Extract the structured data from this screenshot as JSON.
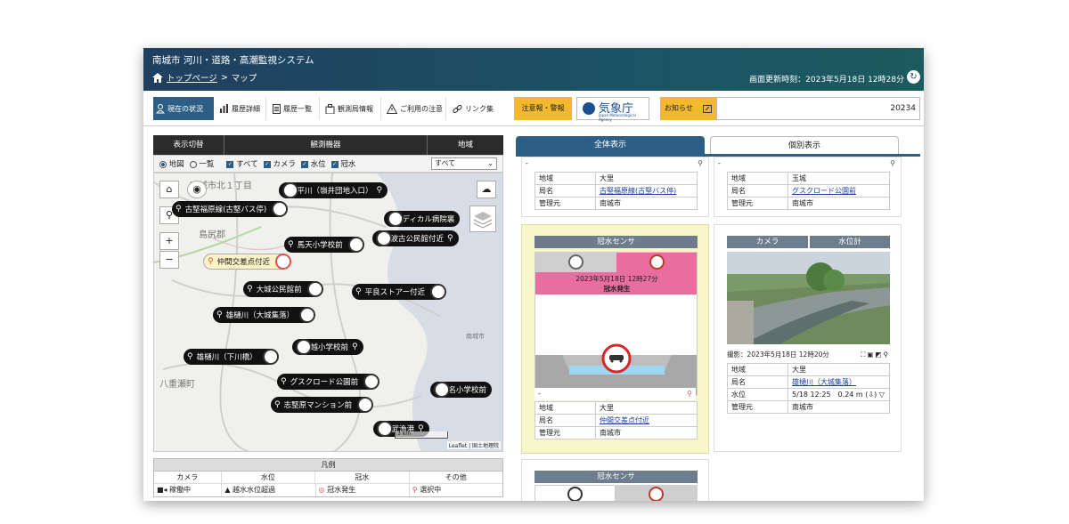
{
  "header": {
    "system_title": "南城市 河川・道路・高潮監視システム",
    "breadcrumb_home": "トップページ",
    "breadcrumb_sep": ">",
    "breadcrumb_current": "マップ",
    "updated_label": "画面更新時刻：2023年5月18日 12時28分"
  },
  "toolbar": {
    "items": [
      {
        "label": "現在の状況",
        "icon": "person-pin-icon"
      },
      {
        "label": "履歴詳細",
        "icon": "bar-chart-icon"
      },
      {
        "label": "履歴一覧",
        "icon": "list-icon"
      },
      {
        "label": "観測局情報",
        "icon": "building-icon"
      },
      {
        "label": "ご利用の注意",
        "icon": "warning-icon"
      },
      {
        "label": "リンク集",
        "icon": "link-icon"
      }
    ],
    "alert_label": "注意報・警報",
    "jma_name": "気象庁",
    "jma_sub": "Japan Meteorological Agency",
    "notice_label": "お知らせ",
    "notice_text": "20234"
  },
  "left_panel": {
    "headers": [
      "表示切替",
      "観測機器",
      "地域"
    ],
    "view_options": [
      "地図",
      "一覧"
    ],
    "filters": [
      "すべて",
      "カメラ",
      "水位",
      "冠水"
    ],
    "region_select": "すべて"
  },
  "map": {
    "area_labels": [
      "南城市北１丁目",
      "島尻郡",
      "八重瀬町",
      "南城市"
    ],
    "markers": [
      {
        "label": "宮平川（嶺井団地入口）"
      },
      {
        "label": "古堅福原線(古堅バス停)"
      },
      {
        "label": "メディカル病院裏"
      },
      {
        "label": "津波古公民館付近"
      },
      {
        "label": "馬天小学校前"
      },
      {
        "label": "仲間交差点付近"
      },
      {
        "label": "大城公民館前"
      },
      {
        "label": "平良ストアー付近"
      },
      {
        "label": "雄樋川（大城集落）"
      },
      {
        "label": "船越小学校前"
      },
      {
        "label": "雄樋川（下川橋）"
      },
      {
        "label": "グスクロード公園前"
      },
      {
        "label": "百名小学校前"
      },
      {
        "label": "志堅原マンション前"
      },
      {
        "label": "奥武漁港"
      }
    ],
    "scale": "3 km",
    "attribution": "Leaflet | 国土地理院"
  },
  "legend": {
    "title": "凡例",
    "columns": [
      "カメラ",
      "水位",
      "冠水",
      "その他"
    ],
    "row": [
      "稼働中",
      "越水水位超過",
      "冠水発生",
      "選択中"
    ]
  },
  "tabs": {
    "all": "全体表示",
    "individual": "個別表示"
  },
  "cards": {
    "c1": {
      "dash": "-",
      "region_k": "地域",
      "region_v": "大里",
      "station_k": "局名",
      "station_v": "古堅福原線(古堅バス停)",
      "admin_k": "管理元",
      "admin_v": "南城市"
    },
    "c2": {
      "dash": "-",
      "region_k": "地域",
      "region_v": "玉城",
      "station_k": "局名",
      "station_v": "グスクロード公園前",
      "admin_k": "管理元",
      "admin_v": "南城市"
    },
    "c3": {
      "title": "冠水センサ",
      "time": "2023年5月18日 12時27分",
      "status": "冠水発生",
      "dash": "-",
      "region_k": "地域",
      "region_v": "大里",
      "station_k": "局名",
      "station_v": "仲間交差点付近",
      "admin_k": "管理元",
      "admin_v": "南城市"
    },
    "c4": {
      "tab_camera": "カメラ",
      "tab_water": "水位計",
      "photo_caption": "撮影：2023年5月18日 12時20分",
      "region_k": "地域",
      "region_v": "大里",
      "station_k": "局名",
      "station_v": "雄樋川（大城集落）",
      "level_k": "水位",
      "level_v": "5/18 12:25　0.24 m (⇩) ▽",
      "admin_k": "管理元",
      "admin_v": "南城市"
    },
    "c5": {
      "title": "冠水センサ"
    }
  },
  "colors": {
    "header_bg": "#1f3f5f",
    "accent": "#2d5f86",
    "alert": "#f1b92b",
    "flood": "#e96ea0",
    "highlight": "#f8f6c9"
  }
}
